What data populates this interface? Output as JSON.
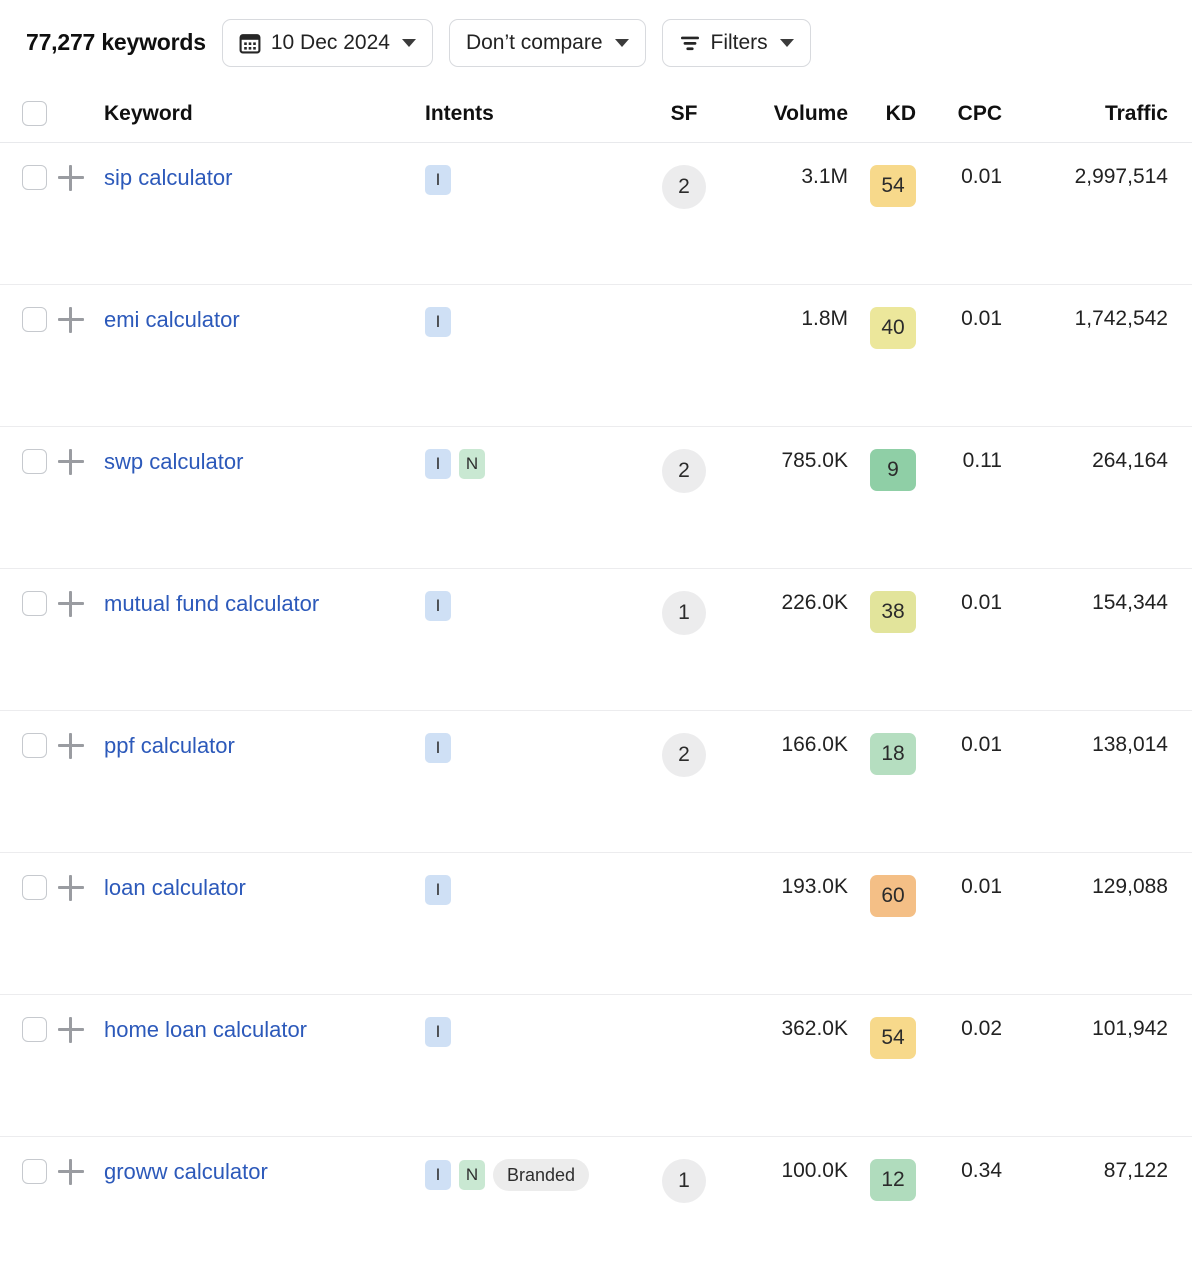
{
  "toolbar": {
    "keyword_count_label": "77,277 keywords",
    "date_button": {
      "label": "10 Dec 2024",
      "icon": "calendar-icon"
    },
    "compare_button": {
      "label": "Don’t compare"
    },
    "filters_button": {
      "label": "Filters",
      "icon": "filter-lines-icon"
    }
  },
  "table": {
    "columns": {
      "keyword": "Keyword",
      "intents": "Intents",
      "sf": "SF",
      "volume": "Volume",
      "kd": "KD",
      "cpc": "CPC",
      "traffic": "Traffic"
    },
    "kd_colors": {
      "easy": "#a8d9b4",
      "low_medium": "#dfe49a",
      "medium": "#f7d98b",
      "hard": "#f5c38a"
    },
    "rows": [
      {
        "keyword": "sip calculator",
        "intents": [
          "I"
        ],
        "intent_pill": "",
        "sf": "2",
        "volume": "3.1M",
        "kd": "54",
        "kd_color": "#f7d98b",
        "cpc": "0.01",
        "traffic": "2,997,514"
      },
      {
        "keyword": "emi calculator",
        "intents": [
          "I"
        ],
        "intent_pill": "",
        "sf": "",
        "volume": "1.8M",
        "kd": "40",
        "kd_color": "#ece79b",
        "cpc": "0.01",
        "traffic": "1,742,542"
      },
      {
        "keyword": "swp calculator",
        "intents": [
          "I",
          "N"
        ],
        "intent_pill": "",
        "sf": "2",
        "volume": "785.0K",
        "kd": "9",
        "kd_color": "#8fcfa6",
        "cpc": "0.11",
        "traffic": "264,164"
      },
      {
        "keyword": "mutual fund calculator",
        "intents": [
          "I"
        ],
        "intent_pill": "",
        "sf": "1",
        "volume": "226.0K",
        "kd": "38",
        "kd_color": "#e2e49b",
        "cpc": "0.01",
        "traffic": "154,344"
      },
      {
        "keyword": "ppf calculator",
        "intents": [
          "I"
        ],
        "intent_pill": "",
        "sf": "2",
        "volume": "166.0K",
        "kd": "18",
        "kd_color": "#b5dec0",
        "cpc": "0.01",
        "traffic": "138,014"
      },
      {
        "keyword": "loan calculator",
        "intents": [
          "I"
        ],
        "intent_pill": "",
        "sf": "",
        "volume": "193.0K",
        "kd": "60",
        "kd_color": "#f4bf86",
        "cpc": "0.01",
        "traffic": "129,088"
      },
      {
        "keyword": "home loan calculator",
        "intents": [
          "I"
        ],
        "intent_pill": "",
        "sf": "",
        "volume": "362.0K",
        "kd": "54",
        "kd_color": "#f7d98b",
        "cpc": "0.02",
        "traffic": "101,942"
      },
      {
        "keyword": "groww calculator",
        "intents": [
          "I",
          "N"
        ],
        "intent_pill": "Branded",
        "sf": "1",
        "volume": "100.0K",
        "kd": "12",
        "kd_color": "#b0dcbd",
        "cpc": "0.34",
        "traffic": "87,122"
      }
    ]
  }
}
